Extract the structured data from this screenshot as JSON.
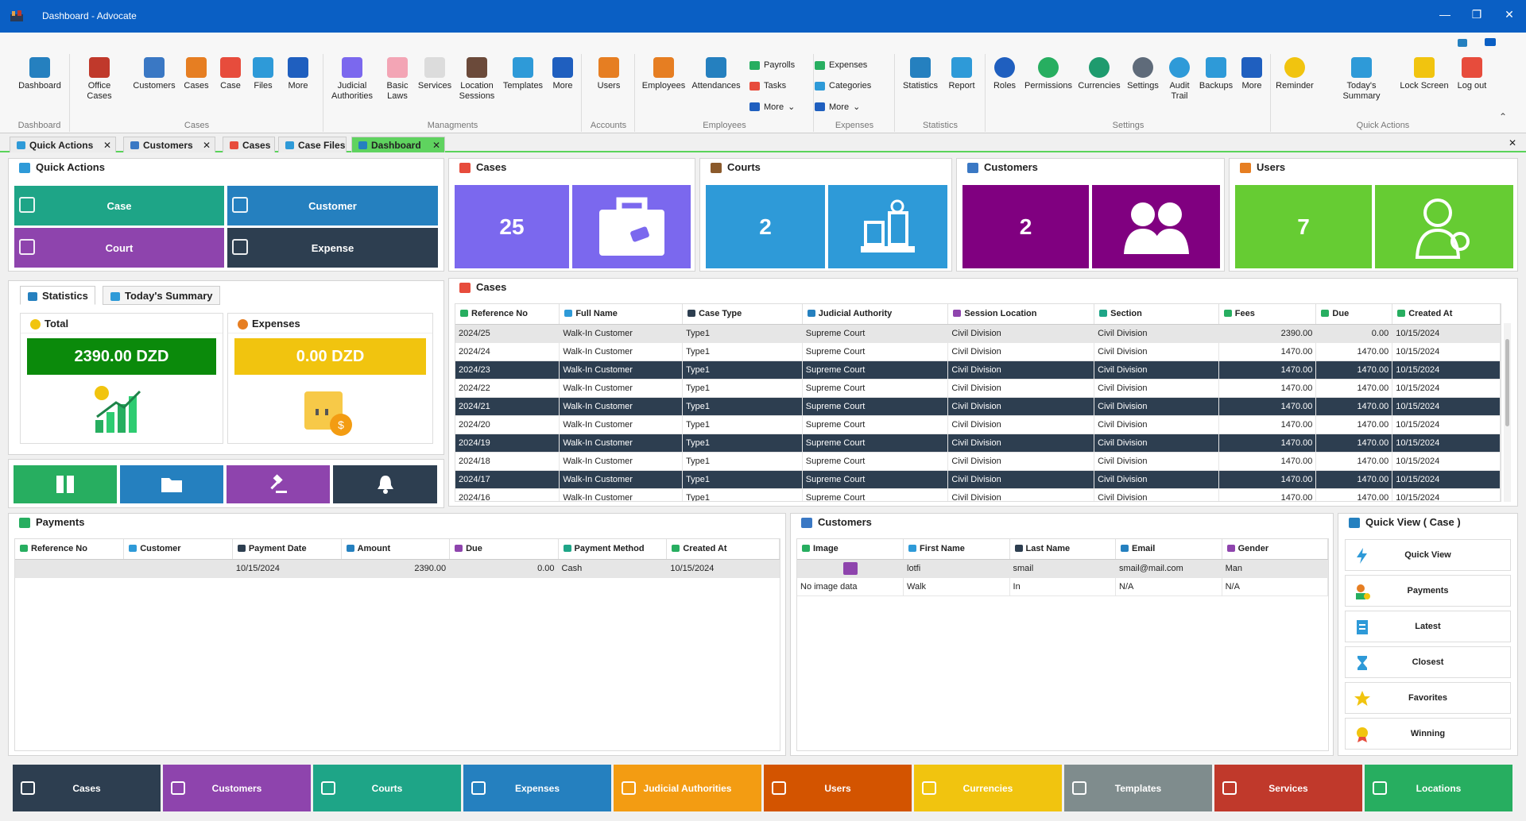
{
  "window": {
    "title": "Dashboard - Advocate"
  },
  "ribbon": {
    "groups": {
      "dashboard": "Dashboard",
      "cases": "Cases",
      "managments": "Managments",
      "accounts": "Accounts",
      "employees": "Employees",
      "expenses": "Expenses",
      "statistics": "Statistics",
      "settings": "Settings",
      "quick_actions": "Quick Actions"
    },
    "buttons": {
      "dashboard": "Dashboard",
      "office_cases": "Office Cases",
      "customers": "Customers",
      "cases": "Cases",
      "case": "Case",
      "files": "Files",
      "more1": "More",
      "judicial_l1": "Judicial",
      "judicial_l2": "Authorities",
      "basic_l1": "Basic",
      "basic_l2": "Laws",
      "services": "Services",
      "location_l1": "Location",
      "location_l2": "Sessions",
      "templates": "Templates",
      "more2": "More",
      "users": "Users",
      "employees": "Employees",
      "attendances": "Attendances",
      "payrolls": "Payrolls",
      "tasks": "Tasks",
      "more3": "More",
      "expenses": "Expenses",
      "categories": "Categories",
      "more4": "More",
      "statistics": "Statistics",
      "report": "Report",
      "roles": "Roles",
      "permissions": "Permissions",
      "currencies": "Currencies",
      "settings": "Settings",
      "audit_l1": "Audit",
      "audit_l2": "Trail",
      "backups": "Backups",
      "more5": "More",
      "reminder": "Reminder",
      "todays_summary": "Today's Summary",
      "lock_screen": "Lock Screen",
      "log_out": "Log out"
    }
  },
  "tabs": [
    "Quick Actions",
    "Customers",
    "Cases",
    "Case Files",
    "Dashboard"
  ],
  "quick_actions": {
    "title": "Quick Actions",
    "buttons": [
      "Case",
      "Customer",
      "Court",
      "Expense"
    ]
  },
  "stats": [
    {
      "title": "Cases",
      "value": "25"
    },
    {
      "title": "Courts",
      "value": "2"
    },
    {
      "title": "Customers",
      "value": "2"
    },
    {
      "title": "Users",
      "value": "7"
    }
  ],
  "summary_tabs": [
    "Statistics",
    "Today's Summary"
  ],
  "total_card": {
    "title": "Total",
    "value": "2390.00 DZD"
  },
  "expenses_card": {
    "title": "Expenses",
    "value": "0.00 DZD"
  },
  "cases_table": {
    "title": "Cases",
    "columns": [
      "Reference No",
      "Full Name",
      "Case Type",
      "Judicial Authority",
      "Session Location",
      "Section",
      "Fees",
      "Due",
      "Created At"
    ],
    "rows": [
      [
        "2024/25",
        "Walk-In Customer",
        "Type1",
        "Supreme Court",
        "Civil Division",
        "Civil Division",
        "2390.00",
        "0.00",
        "10/15/2024"
      ],
      [
        "2024/24",
        "Walk-In Customer",
        "Type1",
        "Supreme Court",
        "Civil Division",
        "Civil Division",
        "1470.00",
        "1470.00",
        "10/15/2024"
      ],
      [
        "2024/23",
        "Walk-In Customer",
        "Type1",
        "Supreme Court",
        "Civil Division",
        "Civil Division",
        "1470.00",
        "1470.00",
        "10/15/2024"
      ],
      [
        "2024/22",
        "Walk-In Customer",
        "Type1",
        "Supreme Court",
        "Civil Division",
        "Civil Division",
        "1470.00",
        "1470.00",
        "10/15/2024"
      ],
      [
        "2024/21",
        "Walk-In Customer",
        "Type1",
        "Supreme Court",
        "Civil Division",
        "Civil Division",
        "1470.00",
        "1470.00",
        "10/15/2024"
      ],
      [
        "2024/20",
        "Walk-In Customer",
        "Type1",
        "Supreme Court",
        "Civil Division",
        "Civil Division",
        "1470.00",
        "1470.00",
        "10/15/2024"
      ],
      [
        "2024/19",
        "Walk-In Customer",
        "Type1",
        "Supreme Court",
        "Civil Division",
        "Civil Division",
        "1470.00",
        "1470.00",
        "10/15/2024"
      ],
      [
        "2024/18",
        "Walk-In Customer",
        "Type1",
        "Supreme Court",
        "Civil Division",
        "Civil Division",
        "1470.00",
        "1470.00",
        "10/15/2024"
      ],
      [
        "2024/17",
        "Walk-In Customer",
        "Type1",
        "Supreme Court",
        "Civil Division",
        "Civil Division",
        "1470.00",
        "1470.00",
        "10/15/2024"
      ],
      [
        "2024/16",
        "Walk-In Customer",
        "Type1",
        "Supreme Court",
        "Civil Division",
        "Civil Division",
        "1470.00",
        "1470.00",
        "10/15/2024"
      ]
    ]
  },
  "payments": {
    "title": "Payments",
    "columns": [
      "Reference No",
      "Customer",
      "Payment Date",
      "Amount",
      "Due",
      "Payment Method",
      "Created At"
    ],
    "rows": [
      [
        "",
        "",
        "10/15/2024",
        "2390.00",
        "0.00",
        "Cash",
        "10/15/2024"
      ]
    ]
  },
  "customers": {
    "title": "Customers",
    "columns": [
      "Image",
      "First Name",
      "Last Name",
      "Email",
      "Gender"
    ],
    "rows": [
      [
        "",
        "lotfi",
        "smail",
        "smail@mail.com",
        "Man"
      ],
      [
        "No image data",
        "Walk",
        "In",
        "N/A",
        "N/A"
      ]
    ]
  },
  "quick_view": {
    "title": "Quick View ( Case )",
    "buttons": [
      "Quick View",
      "Payments",
      "Latest",
      "Closest",
      "Favorites",
      "Winning"
    ]
  },
  "bottom_nav": [
    "Cases",
    "Customers",
    "Courts",
    "Expenses",
    "Judicial Authorities",
    "Users",
    "Currencies",
    "Templates",
    "Services",
    "Locations"
  ],
  "colors": {
    "teal": "#1ea587",
    "blue": "#2580bf",
    "purple": "#8e44ad",
    "navy": "#2d3e50",
    "violet": "#7b68ee",
    "sky": "#2e9ad8",
    "magenta": "#800080",
    "lime": "#66cc33",
    "green_total": "#0b8a0b",
    "yellow": "#f1c40f",
    "orange": "#f39c12",
    "dark_orange": "#d35400",
    "grey": "#7f8c8d",
    "red": "#c0392b",
    "green": "#27ae60"
  }
}
